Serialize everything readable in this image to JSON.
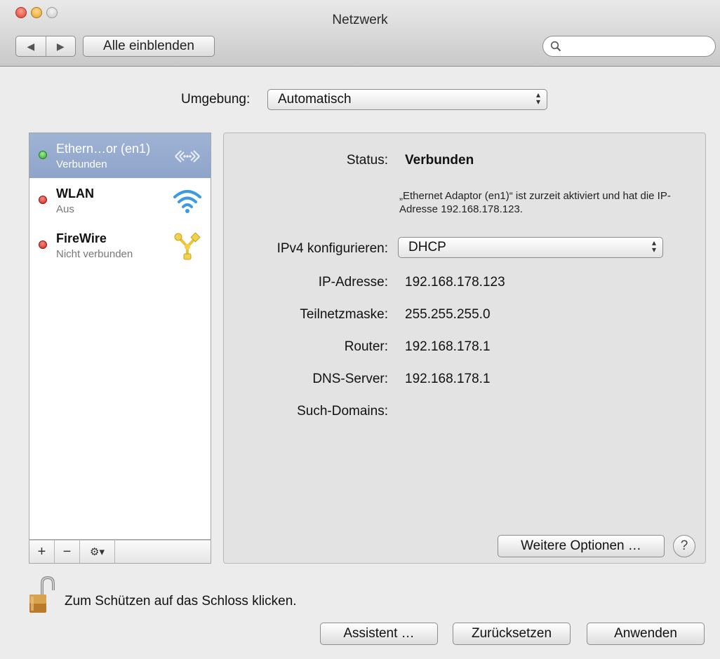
{
  "window": {
    "title": "Netzwerk"
  },
  "toolbar": {
    "back_glyph": "◀",
    "forward_glyph": "▶",
    "show_all_label": "Alle einblenden",
    "search_placeholder": "",
    "search_icon": "magnifier-icon"
  },
  "location": {
    "label": "Umgebung:",
    "value": "Automatisch"
  },
  "services": [
    {
      "name": "Ethern…or (en1)",
      "status": "Verbunden",
      "status_color": "#2fa52a",
      "icon": "ethernet-icon",
      "selected": true
    },
    {
      "name": "WLAN",
      "status": "Aus",
      "status_color": "#d0211a",
      "icon": "wifi-icon",
      "selected": false
    },
    {
      "name": "FireWire",
      "status": "Nicht verbunden",
      "status_color": "#d0211a",
      "icon": "firewire-icon",
      "selected": false
    }
  ],
  "list_controls": {
    "add": "+",
    "remove": "−",
    "action": "⚙▾"
  },
  "detail": {
    "status_label": "Status:",
    "status_value": "Verbunden",
    "status_description": "„Ethernet Adaptor (en1)“ ist zurzeit aktiviert und hat die IP-Adresse 192.168.178.123.",
    "ipv4_label": "IPv4 konfigurieren:",
    "ipv4_value": "DHCP",
    "ip_label": "IP-Adresse:",
    "ip_value": "192.168.178.123",
    "mask_label": "Teilnetzmaske:",
    "mask_value": "255.255.255.0",
    "router_label": "Router:",
    "router_value": "192.168.178.1",
    "dns_label": "DNS-Server:",
    "dns_value": "192.168.178.1",
    "search_domains_label": "Such-Domains:",
    "search_domains_value": "",
    "advanced_label": "Weitere Optionen …",
    "help_label": "?"
  },
  "footer": {
    "lock_text": "Zum Schützen auf das Schloss klicken.",
    "assistant_label": "Assistent …",
    "revert_label": "Zurücksetzen",
    "apply_label": "Anwenden"
  },
  "colors": {
    "selection": "#8ea4c9",
    "window_bg": "#ececec",
    "pane_bg": "#e3e3e3"
  }
}
